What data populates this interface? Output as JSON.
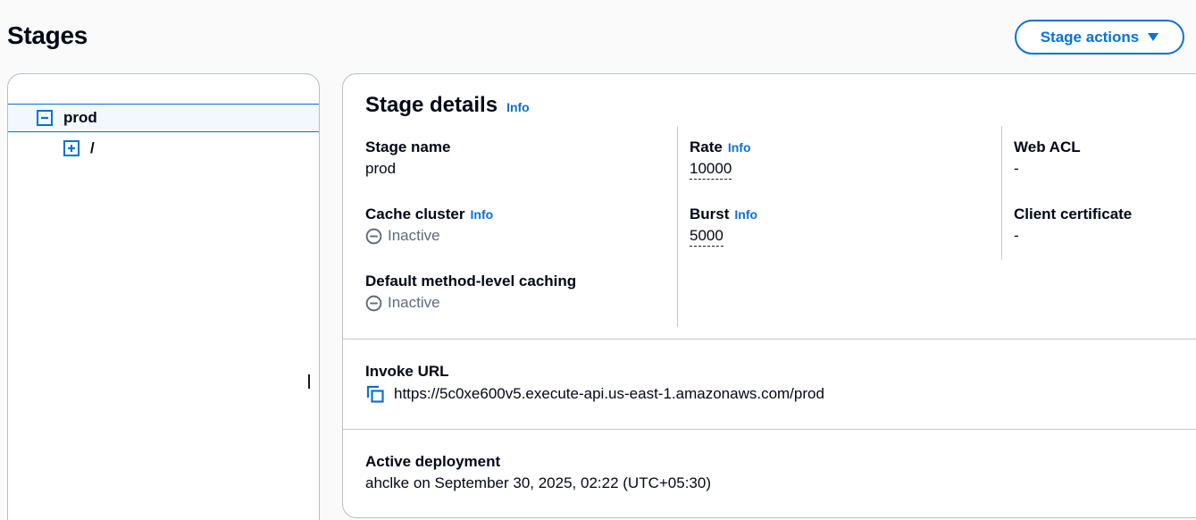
{
  "header": {
    "title": "Stages",
    "actions_label": "Stage actions"
  },
  "tree": {
    "items": [
      {
        "label": "prod",
        "selected": true,
        "toggle": "collapse-icon"
      },
      {
        "label": "/",
        "selected": false,
        "toggle": "expand-icon"
      }
    ]
  },
  "details": {
    "title": "Stage details",
    "info": "Info",
    "fields": {
      "stage_name": {
        "label": "Stage name",
        "value": "prod"
      },
      "cache_cluster": {
        "label": "Cache cluster",
        "info": "Info",
        "value": "Inactive"
      },
      "default_caching": {
        "label": "Default method-level caching",
        "value": "Inactive"
      },
      "rate": {
        "label": "Rate",
        "info": "Info",
        "value": "10000"
      },
      "burst": {
        "label": "Burst",
        "info": "Info",
        "value": "5000"
      },
      "web_acl": {
        "label": "Web ACL",
        "value": "-"
      },
      "client_certificate": {
        "label": "Client certificate",
        "value": "-"
      }
    },
    "invoke": {
      "label": "Invoke URL",
      "url": "https://5c0xe600v5.execute-api.us-east-1.amazonaws.com/prod",
      "icon": "copy-icon"
    },
    "deployment": {
      "label": "Active deployment",
      "value": "ahclke on September 30, 2025, 02:22 (UTC+05:30)"
    }
  },
  "colors": {
    "accent": "#0972d3",
    "text": "#000716",
    "muted": "#5f6b7a",
    "border": "#b6bec9"
  }
}
